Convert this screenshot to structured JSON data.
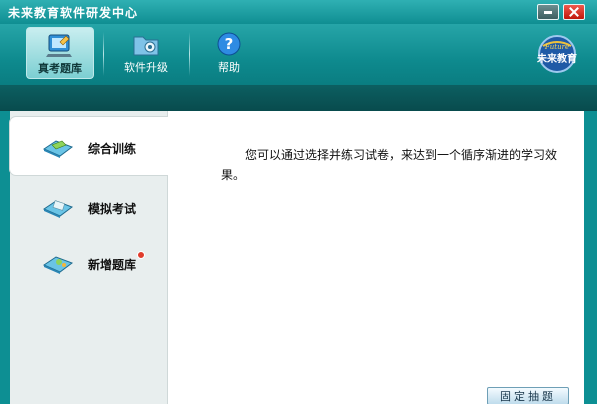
{
  "window": {
    "title": "未来教育软件研发中心"
  },
  "toolbar": {
    "items": [
      {
        "label": "真考题库",
        "icon": "question-bank-icon"
      },
      {
        "label": "软件升级",
        "icon": "folder-gear-icon"
      },
      {
        "label": "帮助",
        "icon": "help-icon"
      }
    ],
    "logo": {
      "top_text": "Future",
      "main_text": "未来教育"
    }
  },
  "sidebar": {
    "items": [
      {
        "label": "综合训练",
        "icon": "book-icon"
      },
      {
        "label": "模拟考试",
        "icon": "book-icon"
      },
      {
        "label": "新增题库",
        "icon": "book-icon"
      }
    ]
  },
  "content": {
    "description": "您可以通过选择并练习试卷，来达到一个循序渐进的学习效果。",
    "fix_button": "固定抽题"
  },
  "colors": {
    "accent": "#0d8f93",
    "dark_band": "#084b4d",
    "close": "#c0180c"
  }
}
